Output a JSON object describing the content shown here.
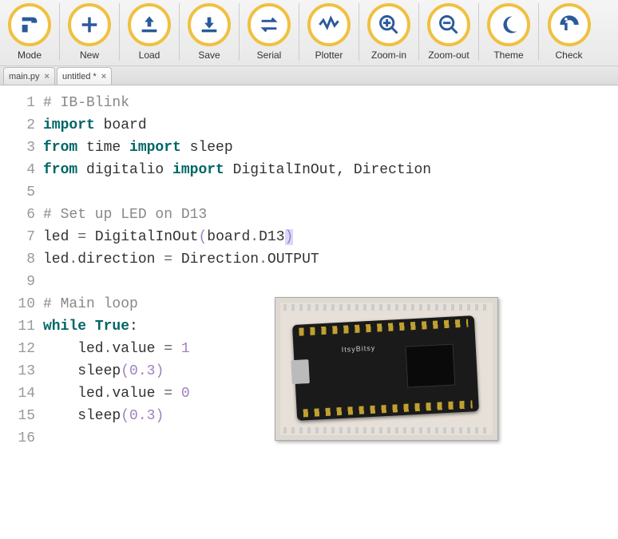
{
  "toolbar": [
    {
      "id": "mode",
      "label": "Mode",
      "icon": "mode-icon"
    },
    {
      "id": "new",
      "label": "New",
      "icon": "plus-icon"
    },
    {
      "id": "load",
      "label": "Load",
      "icon": "load-icon"
    },
    {
      "id": "save",
      "label": "Save",
      "icon": "save-icon"
    },
    {
      "id": "serial",
      "label": "Serial",
      "icon": "serial-icon"
    },
    {
      "id": "plotter",
      "label": "Plotter",
      "icon": "plotter-icon"
    },
    {
      "id": "zoom-in",
      "label": "Zoom-in",
      "icon": "zoom-in-icon"
    },
    {
      "id": "zoom-out",
      "label": "Zoom-out",
      "icon": "zoom-out-icon"
    },
    {
      "id": "theme",
      "label": "Theme",
      "icon": "theme-icon"
    },
    {
      "id": "check",
      "label": "Check",
      "icon": "check-icon"
    }
  ],
  "tabs": [
    {
      "label": "main.py",
      "dirty": false,
      "active": false
    },
    {
      "label": "untitled *",
      "dirty": true,
      "active": true
    }
  ],
  "code": {
    "lines": [
      {
        "n": 1,
        "tokens": [
          {
            "t": "# IB-Blink",
            "c": "comment"
          }
        ]
      },
      {
        "n": 2,
        "tokens": [
          {
            "t": "import",
            "c": "keyword"
          },
          {
            "t": " board",
            "c": "module"
          }
        ]
      },
      {
        "n": 3,
        "tokens": [
          {
            "t": "from",
            "c": "keyword"
          },
          {
            "t": " time ",
            "c": "module"
          },
          {
            "t": "import",
            "c": "keyword"
          },
          {
            "t": " sleep",
            "c": "module"
          }
        ]
      },
      {
        "n": 4,
        "tokens": [
          {
            "t": "from",
            "c": "keyword"
          },
          {
            "t": " digitalio ",
            "c": "module"
          },
          {
            "t": "import",
            "c": "keyword"
          },
          {
            "t": " DigitalInOut, Direction",
            "c": "module"
          }
        ]
      },
      {
        "n": 5,
        "tokens": []
      },
      {
        "n": 6,
        "tokens": [
          {
            "t": "# Set up LED on D13",
            "c": "comment"
          }
        ]
      },
      {
        "n": 7,
        "tokens": [
          {
            "t": "led ",
            "c": "name"
          },
          {
            "t": "=",
            "c": "punct"
          },
          {
            "t": " DigitalInOut",
            "c": "name"
          },
          {
            "t": "(",
            "c": "paren"
          },
          {
            "t": "board",
            "c": "name"
          },
          {
            "t": ".",
            "c": "punct"
          },
          {
            "t": "D13",
            "c": "name"
          },
          {
            "t": ")",
            "c": "paren",
            "cursor": true
          }
        ]
      },
      {
        "n": 8,
        "tokens": [
          {
            "t": "led",
            "c": "name"
          },
          {
            "t": ".",
            "c": "punct"
          },
          {
            "t": "direction ",
            "c": "name"
          },
          {
            "t": "=",
            "c": "punct"
          },
          {
            "t": " Direction",
            "c": "name"
          },
          {
            "t": ".",
            "c": "punct"
          },
          {
            "t": "OUTPUT",
            "c": "name"
          }
        ]
      },
      {
        "n": 9,
        "tokens": []
      },
      {
        "n": 10,
        "tokens": [
          {
            "t": "# Main loop",
            "c": "comment"
          }
        ]
      },
      {
        "n": 11,
        "tokens": [
          {
            "t": "while",
            "c": "keyword"
          },
          {
            "t": " ",
            "c": "name"
          },
          {
            "t": "True",
            "c": "builtin"
          },
          {
            "t": ":",
            "c": "colon"
          }
        ]
      },
      {
        "n": 12,
        "tokens": [
          {
            "t": "    led",
            "c": "name"
          },
          {
            "t": ".",
            "c": "punct"
          },
          {
            "t": "value ",
            "c": "name"
          },
          {
            "t": "=",
            "c": "punct"
          },
          {
            "t": " ",
            "c": "name"
          },
          {
            "t": "1",
            "c": "number"
          }
        ]
      },
      {
        "n": 13,
        "tokens": [
          {
            "t": "    sleep",
            "c": "name"
          },
          {
            "t": "(",
            "c": "paren"
          },
          {
            "t": "0.3",
            "c": "number"
          },
          {
            "t": ")",
            "c": "paren"
          }
        ]
      },
      {
        "n": 14,
        "tokens": [
          {
            "t": "    led",
            "c": "name"
          },
          {
            "t": ".",
            "c": "punct"
          },
          {
            "t": "value ",
            "c": "name"
          },
          {
            "t": "=",
            "c": "punct"
          },
          {
            "t": " ",
            "c": "name"
          },
          {
            "t": "0",
            "c": "number"
          }
        ]
      },
      {
        "n": 15,
        "tokens": [
          {
            "t": "    sleep",
            "c": "name"
          },
          {
            "t": "(",
            "c": "paren"
          },
          {
            "t": "0.3",
            "c": "number"
          },
          {
            "t": ")",
            "c": "paren"
          }
        ]
      },
      {
        "n": 16,
        "tokens": []
      }
    ]
  },
  "board_overlay": {
    "caption": "ItsyBitsy"
  }
}
